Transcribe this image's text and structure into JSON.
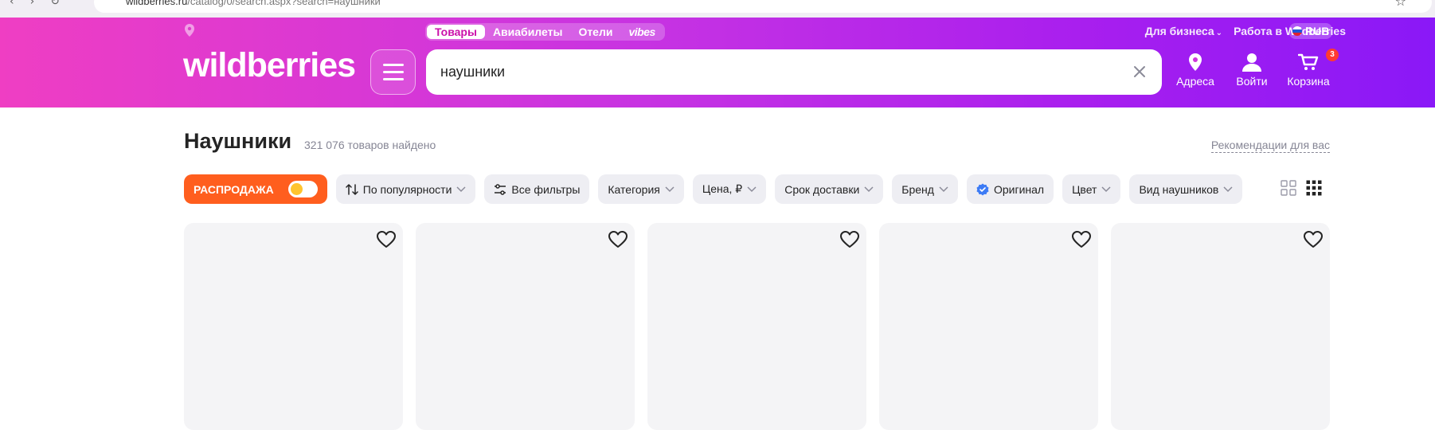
{
  "browser": {
    "url_domain": "wildberries.ru",
    "url_path": "/catalog/0/search.aspx?search=наушники"
  },
  "header": {
    "logo_text": "wildberries",
    "top_tabs": [
      {
        "label": "Товары",
        "active": true
      },
      {
        "label": "Авиабилеты",
        "active": false
      },
      {
        "label": "Отели",
        "active": false
      },
      {
        "label": "vibes",
        "active": false
      }
    ],
    "links": {
      "business": "Для бизнеса",
      "work": "Работа в Wildberries",
      "currency": "RUB"
    },
    "search": {
      "value": "наушники"
    },
    "actions": {
      "address": "Адреса",
      "login": "Войти",
      "cart": "Корзина",
      "cart_count": "3"
    }
  },
  "main": {
    "title": "Наушники",
    "count": "321 076 товаров найдено",
    "recommendations": "Рекомендации для вас",
    "filters": {
      "sale": "РАСПРОДАЖА",
      "sort": "По популярности",
      "all_filters": "Все фильтры",
      "category": "Категория",
      "price": "Цена, ₽",
      "delivery": "Срок доставки",
      "brand": "Бренд",
      "original": "Оригинал",
      "color": "Цвет",
      "headphone_type": "Вид наушников"
    },
    "cards_count": 5
  },
  "colors": {
    "brand_pink": "#ef3ec3",
    "brand_purple": "#8a18f7",
    "sale_orange": "#ff5e1e",
    "chip_bg": "#eeeef3",
    "card_bg": "#f4f4f6"
  }
}
